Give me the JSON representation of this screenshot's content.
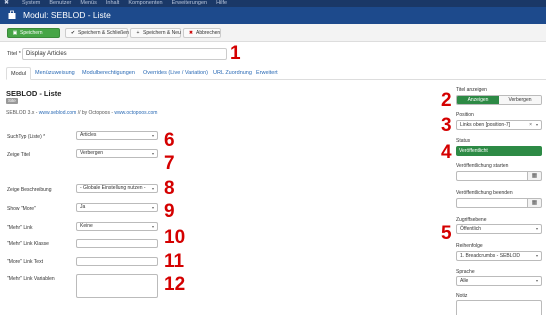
{
  "topnav": {
    "logo": "✖",
    "items": [
      "System",
      "Benutzer",
      "Menüs",
      "Inhalt",
      "Komponenten",
      "Erweiterungen",
      "Hilfe"
    ]
  },
  "titlebar": {
    "icon": "briefcase-icon",
    "title": "Modul: SEBLOD - Liste"
  },
  "toolbar": {
    "save": "Speichern",
    "save_close": "Speichern & Schließen",
    "save_new": "Speichern & Neu",
    "cancel": "Abbrechen"
  },
  "title_field": {
    "label": "Titel *",
    "value": "Display Articles"
  },
  "tabs": [
    "Modul",
    "Menüzuweisung",
    "Modulberechtigungen",
    "Overrides (Live / Variation)",
    "URL Zuordnung",
    "Erweitert"
  ],
  "panel": {
    "heading": "SEBLOD - Liste",
    "badge": "Site",
    "credits_prefix": "SEBLOD 3.x - ",
    "credits_link1": "www.seblod.com",
    "credits_mid": " // by Octopoos - ",
    "credits_link2": "www.octopoos.com"
  },
  "fields": {
    "suchtyp": {
      "label": "SuchTyp (Liste) *",
      "value": "Articles"
    },
    "zeige_titel": {
      "label": "Zeige Titel",
      "value": "Verbergen"
    },
    "zeige_beschreibung": {
      "label": "Zeige Beschreibung",
      "value": "- Globale Einstellung nutzen -"
    },
    "show_more": {
      "label": "Show \"More\"",
      "value": "Ja"
    },
    "mehr_link": {
      "label": "\"Mehr\" Link",
      "value": "Keine"
    },
    "mehr_link_klasse": {
      "label": "\"Mehr\" Link Klasse",
      "value": ""
    },
    "more_link_text": {
      "label": "\"More\" Link Text",
      "value": ""
    },
    "mehr_link_variablen": {
      "label": "\"Mehr\" Link Variablen",
      "value": ""
    }
  },
  "annotations": [
    "1",
    "2",
    "3",
    "4",
    "5",
    "6",
    "7",
    "8",
    "9",
    "10",
    "11",
    "12"
  ],
  "sidebar": {
    "titel_anzeigen": {
      "label": "Titel anzeigen",
      "on": "Anzeigen",
      "off": "Verbergen"
    },
    "position": {
      "label": "Position",
      "value": "Links oben [position-7]"
    },
    "status": {
      "label": "Status",
      "value": "Veröffentlicht"
    },
    "pub_start": {
      "label": "Veröffentlichung starten"
    },
    "pub_end": {
      "label": "Veröffentlichung beenden"
    },
    "zugriffsebene": {
      "label": "Zugriffsebene",
      "value": "Öffentlich"
    },
    "reihenfolge": {
      "label": "Reihenfolge",
      "value": "1. Breadcrumbs - SEBLOD"
    },
    "sprache": {
      "label": "Sprache",
      "value": "Alle"
    },
    "notiz": {
      "label": "Notiz"
    }
  },
  "colors": {
    "nav": "#1a3867",
    "titlebar": "#1d4a8c",
    "save": "#46a546",
    "active_green": "#2d8a45",
    "annotation": "#d40000",
    "link": "#2a6ab5"
  }
}
